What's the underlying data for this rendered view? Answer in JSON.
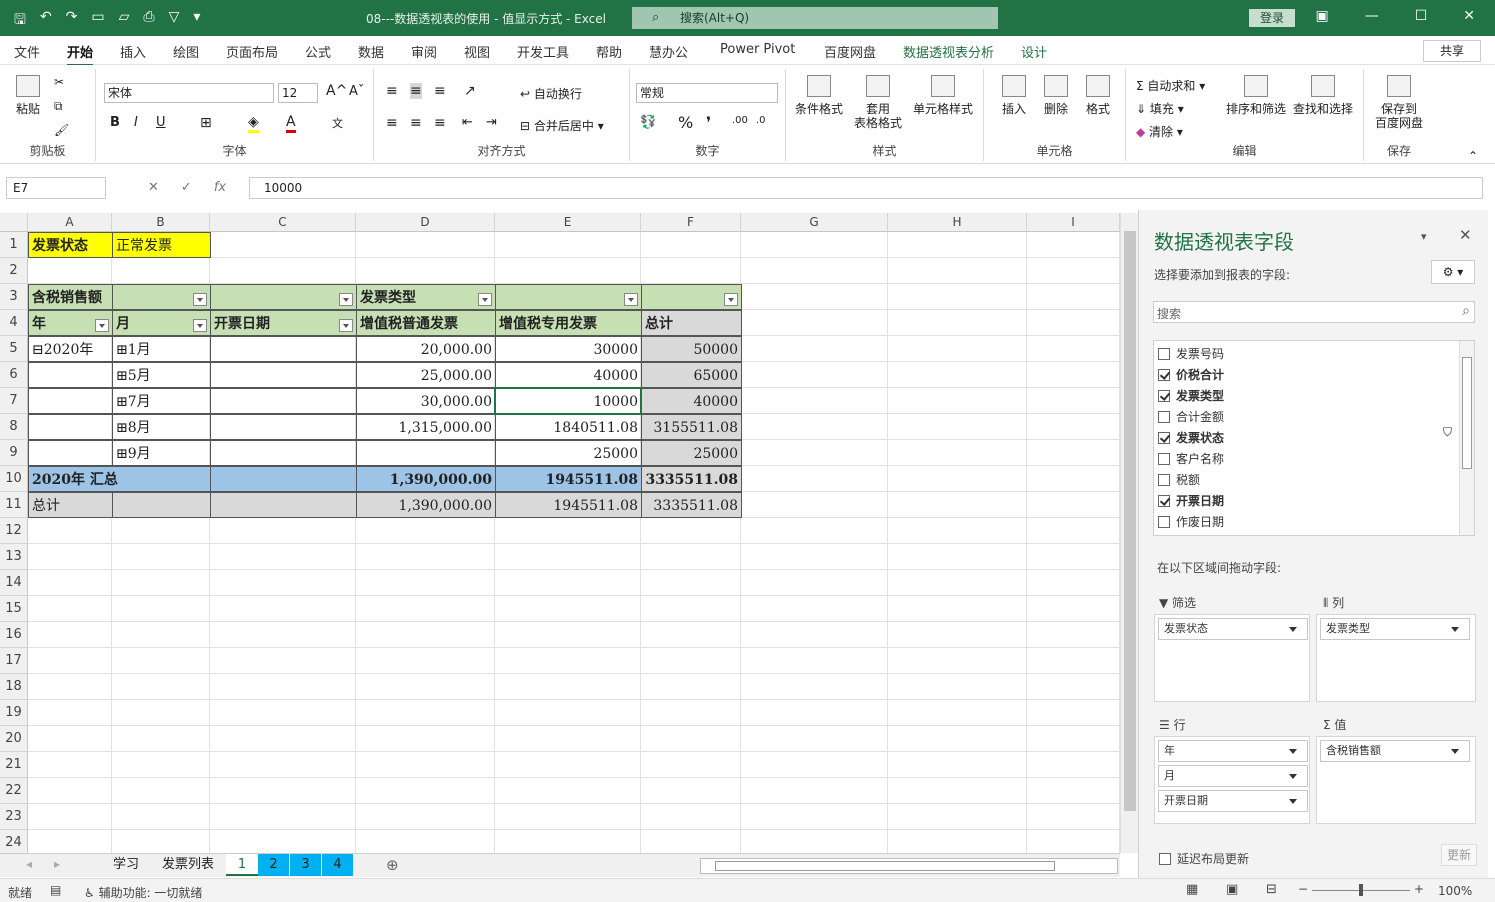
{
  "titlebar": {
    "title": "08---数据透视表的使用 - 值显示方式 - Excel",
    "search": "搜索(Alt+Q)",
    "login": "登录"
  },
  "tabs": [
    "文件",
    "开始",
    "插入",
    "绘图",
    "页面布局",
    "公式",
    "数据",
    "审阅",
    "视图",
    "开发工具",
    "帮助",
    "慧办公",
    "Power Pivot",
    "百度网盘",
    "数据透视表分析",
    "设计"
  ],
  "share": "共享",
  "ribbon": {
    "clipboard": {
      "paste": "粘贴",
      "label": "剪贴板"
    },
    "font": {
      "name": "宋体",
      "size": "12",
      "label": "字体",
      "bold": "B",
      "italic": "I",
      "underline": "U"
    },
    "align": {
      "wrap": "自动换行",
      "merge": "合并后居中",
      "label": "对齐方式"
    },
    "number": {
      "format": "常规",
      "label": "数字"
    },
    "styles": {
      "cond": "条件格式",
      "table_line1": "套用",
      "table_line2": "表格格式",
      "cell": "单元格样式",
      "label": "样式"
    },
    "cells": {
      "insert": "插入",
      "delete": "删除",
      "format": "格式",
      "label": "单元格"
    },
    "edit": {
      "autosum": "自动求和",
      "fill": "填充",
      "clear": "清除",
      "sort": "排序和筛选",
      "find": "查找和选择",
      "label": "编辑"
    },
    "save": {
      "line1": "保存到",
      "line2": "百度网盘",
      "label": "保存"
    }
  },
  "formula": {
    "namebox": "E7",
    "value": "10000"
  },
  "columns": [
    "A",
    "B",
    "C",
    "D",
    "E",
    "F",
    "G",
    "H",
    "I"
  ],
  "rows": [
    "1",
    "2",
    "3",
    "4",
    "5",
    "6",
    "7",
    "8",
    "9",
    "10",
    "11",
    "12",
    "13",
    "14",
    "15",
    "16",
    "17",
    "18",
    "19",
    "20",
    "21",
    "22",
    "23",
    "24"
  ],
  "pivot": {
    "filter_label": "发票状态",
    "filter_value": "正常发票",
    "value_field": "含税销售额",
    "col_field": "发票类型",
    "row_headers": [
      "年",
      "月",
      "开票日期"
    ],
    "col_headers": [
      "增值税普通发票",
      "增值税专用发票",
      "总计"
    ],
    "data": [
      {
        "year": "2020年",
        "month": "1月",
        "d": "20,000.00",
        "e": "30000",
        "f": "50000"
      },
      {
        "year": "",
        "month": "5月",
        "d": "25,000.00",
        "e": "40000",
        "f": "65000"
      },
      {
        "year": "",
        "month": "7月",
        "d": "30,000.00",
        "e": "10000",
        "f": "40000"
      },
      {
        "year": "",
        "month": "8月",
        "d": "1,315,000.00",
        "e": "1840511.08",
        "f": "3155511.08"
      },
      {
        "year": "",
        "month": "9月",
        "d": "",
        "e": "25000",
        "f": "25000"
      }
    ],
    "subtotal": {
      "label": "2020年 汇总",
      "d": "1,390,000.00",
      "e": "1945511.08",
      "f": "3335511.08"
    },
    "total": {
      "label": "总计",
      "d": "1,390,000.00",
      "e": "1945511.08",
      "f": "3335511.08"
    }
  },
  "sheets": [
    "学习",
    "发票列表",
    "1",
    "2",
    "3",
    "4"
  ],
  "status": {
    "ready": "就绪",
    "accessibility": "辅助功能: 一切就绪",
    "zoom": "100%"
  },
  "pane": {
    "title": "数据透视表字段",
    "subtitle": "选择要添加到报表的字段:",
    "search": "搜索",
    "fields": [
      {
        "name": "发票号码",
        "checked": false
      },
      {
        "name": "价税合计",
        "checked": true
      },
      {
        "name": "发票类型",
        "checked": true
      },
      {
        "name": "合计金额",
        "checked": false
      },
      {
        "name": "发票状态",
        "checked": true
      },
      {
        "name": "客户名称",
        "checked": false
      },
      {
        "name": "税额",
        "checked": false
      },
      {
        "name": "开票日期",
        "checked": true
      },
      {
        "name": "作废日期",
        "checked": false
      }
    ],
    "drag_hint": "在以下区域间拖动字段:",
    "filter_hdr": "筛选",
    "col_hdr": "列",
    "row_hdr": "行",
    "val_hdr": "值",
    "filter_items": [
      "发票状态"
    ],
    "col_items": [
      "发票类型"
    ],
    "row_items": [
      "年",
      "月",
      "开票日期"
    ],
    "val_items": [
      "含税销售额"
    ],
    "defer": "延迟布局更新",
    "update": "更新"
  }
}
